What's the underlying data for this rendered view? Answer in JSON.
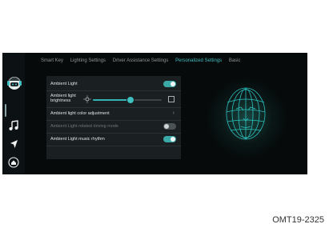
{
  "tabs": [
    {
      "label": "Smart Key",
      "active": false
    },
    {
      "label": "Lighting Settings",
      "active": false
    },
    {
      "label": "Driver Assistance Settings",
      "active": false
    },
    {
      "label": "Personalized Settings",
      "active": true
    },
    {
      "label": "Basic",
      "active": false
    }
  ],
  "rows": {
    "ambient_light": {
      "label": "Ambient Light",
      "on": true
    },
    "brightness": {
      "label_line1": "Ambient light",
      "label_line2": "brightness",
      "level": 0.55
    },
    "color": {
      "label": "Ambient light color adjustment"
    },
    "driving_mode": {
      "label": "Ambient Light related driving mode",
      "on": false
    },
    "music_rhythm": {
      "label": "Ambient Light music rhythm",
      "on": true
    }
  },
  "sidebar": {
    "icons": [
      "avatar-icon",
      "music-note-icon",
      "navigation-arrow-icon",
      "home-icon"
    ]
  },
  "accent_color": "#3fbfc0",
  "caption": "OMT19-2325"
}
